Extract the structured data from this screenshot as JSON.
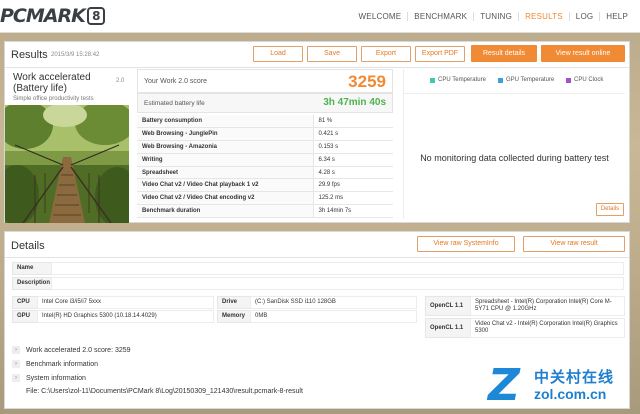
{
  "app": {
    "logo_text": "PCMARK",
    "logo_badge": "8"
  },
  "nav": [
    "WELCOME",
    "BENCHMARK",
    "TUNING",
    "RESULTS",
    "LOG",
    "HELP"
  ],
  "results": {
    "title": "Results",
    "date": "2015/3/9 15:28:42",
    "buttons": {
      "load": "Load",
      "save": "Save",
      "export": "Export",
      "export_pdf": "Export PDF",
      "details": "Result details",
      "online": "View result online"
    },
    "test_name": "Work accelerated (Battery life)",
    "test_version": "2.0",
    "test_subtitle": "Simple office productivity tests",
    "score_label": "Your Work 2.0 score",
    "score_value": "3259",
    "battery_label": "Estimated battery life",
    "battery_value": "3h 47min 40s",
    "metrics": [
      {
        "name": "Battery consumption",
        "value": "81 %"
      },
      {
        "name": "Web Browsing - JunglePin",
        "value": "0.421 s"
      },
      {
        "name": "Web Browsing - Amazonia",
        "value": "0.153 s"
      },
      {
        "name": "Writing",
        "value": "6.34 s"
      },
      {
        "name": "Spreadsheet",
        "value": "4.28 s"
      },
      {
        "name": "Video Chat v2 / Video Chat playback 1 v2",
        "value": "29.9 fps"
      },
      {
        "name": "Video Chat v2 / Video Chat encoding v2",
        "value": "125.2 ms"
      },
      {
        "name": "Benchmark duration",
        "value": "3h 14min 7s"
      }
    ],
    "legend": [
      {
        "label": "CPU Temperature",
        "color": "#3ec9b4"
      },
      {
        "label": "GPU Temperature",
        "color": "#3aa0e0"
      },
      {
        "label": "CPU Clock",
        "color": "#a24fd0"
      }
    ],
    "no_data": "No monitoring data collected during battery test",
    "details_button": "Details"
  },
  "details": {
    "title": "Details",
    "btn_sysinfo": "View raw SystemInfo",
    "btn_raw": "View raw result",
    "name_label": "Name",
    "desc_label": "Description",
    "cpu_label": "CPU",
    "cpu_value": "Intel Core i3/i5/i7 5xxx",
    "gpu_label": "GPU",
    "gpu_value": "Intel(R) HD Graphics 5300 (10.18.14.4029)",
    "drive_label": "Drive",
    "drive_value": "(C:) SanDisk SSD i110 128GB",
    "memory_label": "Memory",
    "memory_value": "0MB",
    "opencl1_label": "OpenCL 1.1",
    "opencl1_value": "Spreadsheet - Intel(R) Corporation Intel(R) Core M-5Y71 CPU @ 1.20GHz",
    "opencl2_label": "OpenCL 1.1",
    "opencl2_value": "Video Chat v2 - Intel(R) Corporation Intel(R) Graphics 5300",
    "rows": [
      "Work accelerated 2.0 score: 3259",
      "Benchmark information",
      "System information"
    ],
    "file_path": "File: C:\\Users\\zol-11\\Documents\\PCMark 8\\Log\\20150309_121430\\result.pcmark-8-result"
  },
  "watermark": {
    "cn": "中关村在线",
    "url": "zol.com.cn"
  }
}
